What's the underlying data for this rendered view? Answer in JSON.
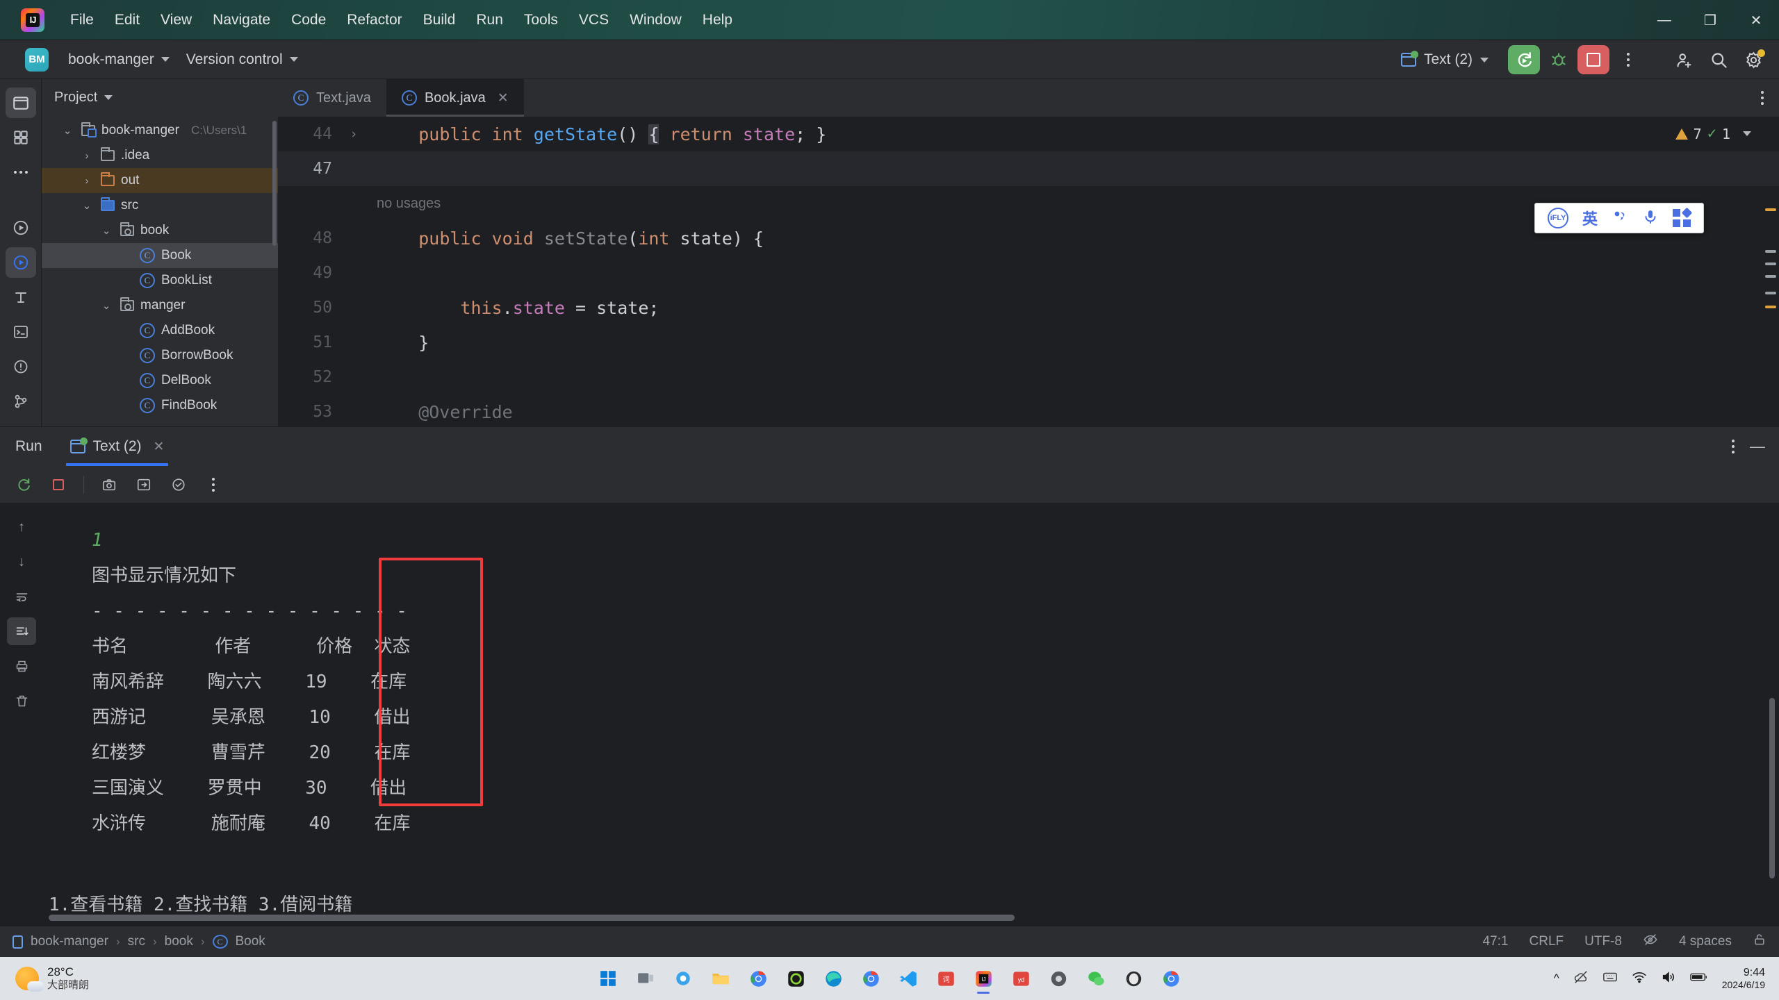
{
  "window": {
    "minimize": "—",
    "maximize": "❐",
    "close": "✕"
  },
  "menubar": {
    "items": [
      "File",
      "Edit",
      "View",
      "Navigate",
      "Code",
      "Refactor",
      "Build",
      "Run",
      "Tools",
      "VCS",
      "Window",
      "Help"
    ]
  },
  "toolbar": {
    "project_badge": "BM",
    "project_name": "book-manger",
    "vcs_label": "Version control",
    "run_config": "Text (2)",
    "icons": [
      "run-button",
      "debug-button",
      "stop-button",
      "more-actions",
      "add-user",
      "search",
      "settings"
    ]
  },
  "project_panel": {
    "title": "Project",
    "tree": [
      {
        "label": "book-manger",
        "path": "C:\\Users\\1",
        "indent": 0,
        "twisty": "⌄",
        "icon": "project-folder",
        "state": "normal"
      },
      {
        "label": ".idea",
        "path": "",
        "indent": 1,
        "twisty": "›",
        "icon": "folder",
        "state": "normal"
      },
      {
        "label": "out",
        "path": "",
        "indent": 1,
        "twisty": "›",
        "icon": "folder-orange",
        "state": "out-selected"
      },
      {
        "label": "src",
        "path": "",
        "indent": 1,
        "twisty": "⌄",
        "icon": "folder-blue",
        "state": "normal"
      },
      {
        "label": "book",
        "path": "",
        "indent": 2,
        "twisty": "⌄",
        "icon": "package",
        "state": "normal"
      },
      {
        "label": "Book",
        "path": "",
        "indent": 3,
        "twisty": "",
        "icon": "class",
        "state": "selected"
      },
      {
        "label": "BookList",
        "path": "",
        "indent": 3,
        "twisty": "",
        "icon": "class",
        "state": "normal"
      },
      {
        "label": "manger",
        "path": "",
        "indent": 2,
        "twisty": "⌄",
        "icon": "package",
        "state": "normal"
      },
      {
        "label": "AddBook",
        "path": "",
        "indent": 3,
        "twisty": "",
        "icon": "class",
        "state": "normal"
      },
      {
        "label": "BorrowBook",
        "path": "",
        "indent": 3,
        "twisty": "",
        "icon": "class",
        "state": "normal"
      },
      {
        "label": "DelBook",
        "path": "",
        "indent": 3,
        "twisty": "",
        "icon": "class",
        "state": "normal"
      },
      {
        "label": "FindBook",
        "path": "",
        "indent": 3,
        "twisty": "",
        "icon": "class",
        "state": "normal"
      }
    ]
  },
  "editor": {
    "tabs": [
      {
        "label": "Text.java",
        "active": false,
        "closable": false
      },
      {
        "label": "Book.java",
        "active": true,
        "closable": true
      }
    ],
    "inspection": {
      "warnings": "7",
      "checks": "1"
    },
    "lines": [
      {
        "num": "44",
        "fold": "›",
        "current": false,
        "annotation": "",
        "segments": [
          {
            "t": "    ",
            "c": "p"
          },
          {
            "t": "public ",
            "c": "k"
          },
          {
            "t": "int ",
            "c": "k"
          },
          {
            "t": "getState",
            "c": "m"
          },
          {
            "t": "()",
            "c": "p"
          },
          {
            "t": " ",
            "c": "p"
          },
          {
            "t": "{",
            "c": "hl"
          },
          {
            "t": " ",
            "c": "p"
          },
          {
            "t": "return ",
            "c": "k"
          },
          {
            "t": "state",
            "c": "f"
          },
          {
            "t": "; ",
            "c": "p"
          },
          {
            "t": "}",
            "c": "p"
          }
        ]
      },
      {
        "num": "47",
        "fold": "",
        "current": true,
        "annotation": "",
        "segments": []
      },
      {
        "num": "48",
        "fold": "",
        "current": false,
        "annotation": "no usages",
        "segments": [
          {
            "t": "    ",
            "c": "p"
          },
          {
            "t": "public ",
            "c": "k"
          },
          {
            "t": "void ",
            "c": "k"
          },
          {
            "t": "setState",
            "c": "gray"
          },
          {
            "t": "(",
            "c": "p"
          },
          {
            "t": "int ",
            "c": "k"
          },
          {
            "t": "state",
            "c": "p"
          },
          {
            "t": ") {",
            "c": "p"
          }
        ]
      },
      {
        "num": "49",
        "fold": "",
        "current": false,
        "annotation": "",
        "segments": []
      },
      {
        "num": "50",
        "fold": "",
        "current": false,
        "annotation": "",
        "segments": [
          {
            "t": "        ",
            "c": "p"
          },
          {
            "t": "this",
            "c": "k"
          },
          {
            "t": ".",
            "c": "p"
          },
          {
            "t": "state",
            "c": "f"
          },
          {
            "t": " = ",
            "c": "p"
          },
          {
            "t": "state",
            "c": "p"
          },
          {
            "t": ";",
            "c": "p"
          }
        ]
      },
      {
        "num": "51",
        "fold": "",
        "current": false,
        "annotation": "",
        "segments": [
          {
            "t": "    }",
            "c": "p"
          }
        ]
      },
      {
        "num": "52",
        "fold": "",
        "current": false,
        "annotation": "",
        "segments": []
      },
      {
        "num": "53",
        "fold": "",
        "current": false,
        "annotation": "",
        "segments": [
          {
            "t": "    @Override",
            "c": "g"
          }
        ]
      }
    ]
  },
  "ime_bar": {
    "logo": "iFLY",
    "mode": "英",
    "items": [
      "ifly-logo-icon",
      "english-mode",
      "punctuation-icon",
      "microphone-icon",
      "apps-grid-icon"
    ]
  },
  "run_panel": {
    "title": "Run",
    "tab": "Text (2)",
    "toolbar_icons": [
      "rerun-icon",
      "stop-icon",
      "camera-icon",
      "export-icon",
      "soft-wrap-icon",
      "more-icon"
    ],
    "rail_icons": [
      "up-arrow",
      "down-arrow",
      "soft-wrap",
      "scroll-end",
      "print",
      "trash"
    ],
    "console": {
      "prompt_number": "1",
      "heading": "图书显示情况如下",
      "divider": "- - - - - - - - - - - - - - -",
      "headers": [
        "书名",
        "作者",
        "价格",
        "状态"
      ],
      "rows": [
        {
          "title": "南风希辞",
          "author": "陶六六",
          "price": "19",
          "state": "在库"
        },
        {
          "title": "西游记",
          "author": "吴承恩",
          "price": "10",
          "state": "借出"
        },
        {
          "title": "红楼梦",
          "author": "曹雪芹",
          "price": "20",
          "state": "在库"
        },
        {
          "title": "三国演义",
          "author": "罗贯中",
          "price": "30",
          "state": "借出"
        },
        {
          "title": "水浒传",
          "author": "施耐庵",
          "price": "40",
          "state": "在库"
        }
      ],
      "menu_line": "1.查看书籍      2.查找书籍      3.借阅书籍",
      "highlight_color": "#f03c3c"
    }
  },
  "statusbar": {
    "breadcrumb": [
      "book-manger",
      "src",
      "book",
      "Book"
    ],
    "caret": "47:1",
    "line_sep": "CRLF",
    "encoding": "UTF-8",
    "indent": "4 spaces"
  },
  "taskbar": {
    "weather_temp": "28°C",
    "weather_desc": "大部晴朗",
    "clock_time": "9:44",
    "clock_date": "2024/6/19",
    "apps": [
      "start-icon",
      "task-view-icon",
      "widgets-icon",
      "file-explorer-icon",
      "chrome-icon",
      "app-green-icon",
      "edge-icon",
      "chrome2-icon",
      "vscode-icon",
      "youdao-icon",
      "intellij-icon",
      "yd-icon",
      "circle-app-icon",
      "wechat-icon",
      "qq-icon",
      "chrome3-icon"
    ]
  }
}
